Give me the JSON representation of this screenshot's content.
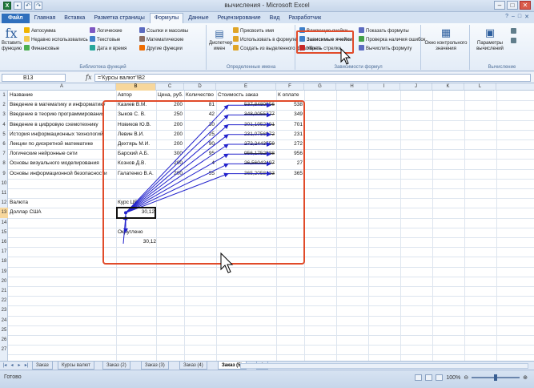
{
  "app": {
    "title": "вычисления - Microsoft Excel",
    "quick_access": [
      "save-icon",
      "undo-icon",
      "redo-icon"
    ]
  },
  "tabs": [
    "Файл",
    "Главная",
    "Вставка",
    "Разметка страницы",
    "Формулы",
    "Данные",
    "Рецензирование",
    "Вид",
    "Разработчик"
  ],
  "active_tab": "Формулы",
  "ribbon": {
    "insert_function": "Вставить функцию",
    "library_buttons": [
      {
        "label": "Автосумма",
        "icon": "sigma-icon"
      },
      {
        "label": "Недавно использовались",
        "icon": "star-icon"
      },
      {
        "label": "Финансовые",
        "icon": "money-icon"
      },
      {
        "label": "Логические",
        "icon": "question-icon"
      },
      {
        "label": "Текстовые",
        "icon": "text-icon"
      },
      {
        "label": "Дата и время",
        "icon": "clock-icon"
      },
      {
        "label": "Ссылки и массивы",
        "icon": "lookup-icon"
      },
      {
        "label": "Математические",
        "icon": "math-icon"
      },
      {
        "label": "Другие функции",
        "icon": "more-icon"
      }
    ],
    "library_label": "Библиотека функций",
    "name_manager": "Диспетчер имен",
    "names_buttons": [
      "Присвоить имя",
      "Использовать в формуле",
      "Создать из выделенного фрагмента"
    ],
    "names_label": "Определенные имена",
    "audit_buttons": [
      "Влияющие ячейки",
      "Зависимые ячейки",
      "Убрать стрелки",
      "Показать формулы",
      "Проверка наличия ошибок",
      "Вычислить формулу"
    ],
    "audit_label": "Зависимости формул",
    "watch_window": "Окно контрольного значения",
    "calc_options": "Параметры вычислений",
    "calc_label": "Вычисление"
  },
  "formula_bar": {
    "name_box": "B13",
    "formula": "='Курсы валют'!B2"
  },
  "columns": [
    "A",
    "B",
    "C",
    "D",
    "E",
    "F",
    "G",
    "H",
    "I",
    "J",
    "K",
    "L"
  ],
  "selected_column": "B",
  "rows": [
    "1",
    "2",
    "3",
    "4",
    "5",
    "6",
    "7",
    "8",
    "9",
    "10",
    "11",
    "12",
    "13",
    "14",
    "15",
    "16",
    "17",
    "18",
    "19",
    "20",
    "21",
    "22",
    "23",
    "24",
    "25",
    "26",
    "27"
  ],
  "selected_row": "13",
  "table_header": [
    "Название",
    "Автор",
    "Цена, руб.",
    "Количество",
    "Стоимость заказ",
    "К оплате"
  ],
  "table_rows": [
    [
      "Введение в математику и информатику",
      "Казиев В.М.",
      "200",
      "81",
      "537,8480056",
      "538"
    ],
    [
      "Введение в теорию программирования",
      "Зыков С. В.",
      "250",
      "42",
      "348,0055777",
      "349"
    ],
    [
      "Введение в цифровую схемотехнику",
      "Новиков Ю.В.",
      "200",
      "30",
      "301,1952191",
      "701"
    ],
    [
      "История информационных технологий",
      "Левин В.И.",
      "200",
      "25",
      "231,0756972",
      "231"
    ],
    [
      "Лекции по дискретной математике",
      "Дехтярь М.И.",
      "200",
      "90",
      "272,2443559",
      "272"
    ],
    [
      "Логические нейронные сети",
      "Барский А.Б.",
      "300",
      "95",
      "956,1752988",
      "956"
    ],
    [
      "Основы визуального моделирования",
      "Кознов Д.В.",
      "200",
      "4",
      "26,56042497",
      "27"
    ],
    [
      "Основы информационной безопасности",
      "Галатенко В.А.",
      "200",
      "55",
      "365,2058433",
      "365"
    ]
  ],
  "currency": {
    "label": "Валюта",
    "rate_label": "Курс ЦБ",
    "row_label": "Доллар США",
    "rate": "30,12",
    "round_label": "Округлено",
    "rounded": "30,12"
  },
  "sheet_tabs": [
    "Заказ",
    "Курсы валют",
    "Заказ (2)",
    "Заказ (3)",
    "Заказ (4)",
    "Заказ (5)"
  ],
  "active_sheet": "Заказ (5)",
  "status": {
    "ready": "Готово",
    "zoom": "100%"
  },
  "colors": {
    "highlight": "#e14b2a",
    "tracer": "#2222cc",
    "selection_header": "#f7d79c"
  }
}
